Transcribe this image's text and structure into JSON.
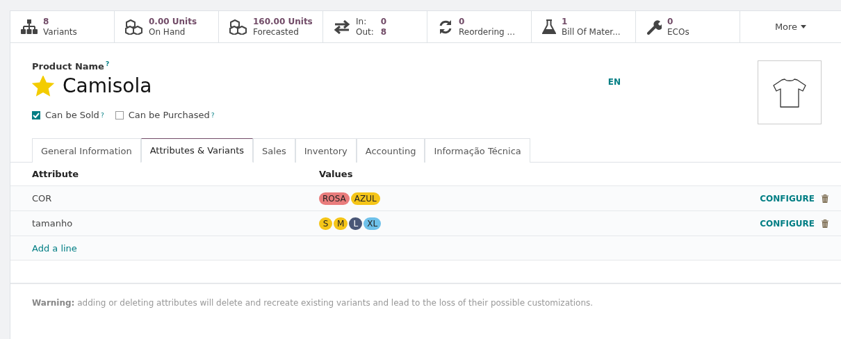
{
  "stat_buttons": [
    {
      "kind": "value",
      "value": "8",
      "label": "Variants"
    },
    {
      "kind": "value",
      "value": "0.00 Units",
      "label": "On Hand"
    },
    {
      "kind": "value",
      "value": "160.00 Units",
      "label": "Forecasted"
    },
    {
      "kind": "inout",
      "in_label": "In:",
      "in_value": "0",
      "out_label": "Out:",
      "out_value": "8"
    },
    {
      "kind": "value",
      "value": "0",
      "label": "Reordering ..."
    },
    {
      "kind": "value",
      "value": "1",
      "label": "Bill Of Mater..."
    },
    {
      "kind": "value",
      "value": "0",
      "label": "ECOs"
    },
    {
      "kind": "more",
      "label": "More"
    }
  ],
  "product": {
    "name_label": "Product Name",
    "help_mark": "?",
    "name": "Camisola",
    "starred": true,
    "language": "EN"
  },
  "checkboxes": [
    {
      "label": "Can be Sold",
      "help_mark": "?",
      "checked": true
    },
    {
      "label": "Can be Purchased",
      "help_mark": "?",
      "checked": false
    }
  ],
  "tabs": [
    {
      "label": "General Information",
      "selected": false
    },
    {
      "label": "Attributes & Variants",
      "selected": true
    },
    {
      "label": "Sales",
      "selected": false
    },
    {
      "label": "Inventory",
      "selected": false
    },
    {
      "label": "Accounting",
      "selected": false
    },
    {
      "label": "Informação Técnica",
      "selected": false
    }
  ],
  "table": {
    "columns": [
      "Attribute",
      "Values"
    ],
    "rows": [
      {
        "attribute": "COR",
        "values": [
          {
            "label": "ROSA",
            "color": "#e97c7c"
          },
          {
            "label": "AZUL",
            "color": "#f5c518"
          }
        ],
        "action": "CONFIGURE"
      },
      {
        "attribute": "tamanho",
        "values": [
          {
            "label": "S",
            "color": "#f5c518"
          },
          {
            "label": "M",
            "color": "#f5c518"
          },
          {
            "label": "L",
            "color": "#4a5777"
          },
          {
            "label": "XL",
            "color": "#6ec1ea"
          }
        ],
        "action": "CONFIGURE"
      }
    ],
    "add_line": "Add a line"
  },
  "warning": {
    "prefix": "Warning:",
    "text": "adding or deleting attributes will delete and recreate existing variants and lead to the loss of their possible customizations."
  }
}
